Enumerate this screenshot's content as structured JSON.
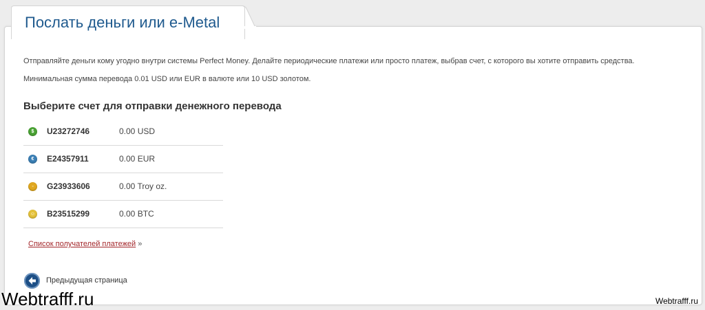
{
  "page": {
    "title": "Послать деньги или e-Metal",
    "intro": "Отправляйте деньги кому угодно внутри системы Perfect Money. Делайте периодические платежи или просто платеж, выбрав счет, с которого вы хотите отправить средства.",
    "min_amount": "Минимальная сумма перевода 0.01 USD или EUR в валюте или 10 USD золотом.",
    "section_heading": "Выберите счет для отправки денежного перевода"
  },
  "accounts": [
    {
      "id": "U23272746",
      "balance": "0.00 USD",
      "icon": "usd-coin-icon",
      "color": "#4aa334"
    },
    {
      "id": "E24357911",
      "balance": "0.00 EUR",
      "icon": "eur-coin-icon",
      "color": "#3b7fb5"
    },
    {
      "id": "G23933606",
      "balance": "0.00 Troy oz.",
      "icon": "gold-coin-icon",
      "color": "#e0a820"
    },
    {
      "id": "B23515299",
      "balance": "0.00 BTC",
      "icon": "btc-coin-icon",
      "color": "#e5c23a"
    }
  ],
  "links": {
    "recipients_label": "Список получателей платежей",
    "recipients_suffix": "»",
    "prev_page_label": "Предыдущая страница"
  },
  "watermark": {
    "left": "Webtrafff.ru",
    "right": "Webtrafff.ru"
  },
  "colors": {
    "title": "#1f5a8e",
    "link": "#a3262a",
    "button": "#1d4f86"
  }
}
